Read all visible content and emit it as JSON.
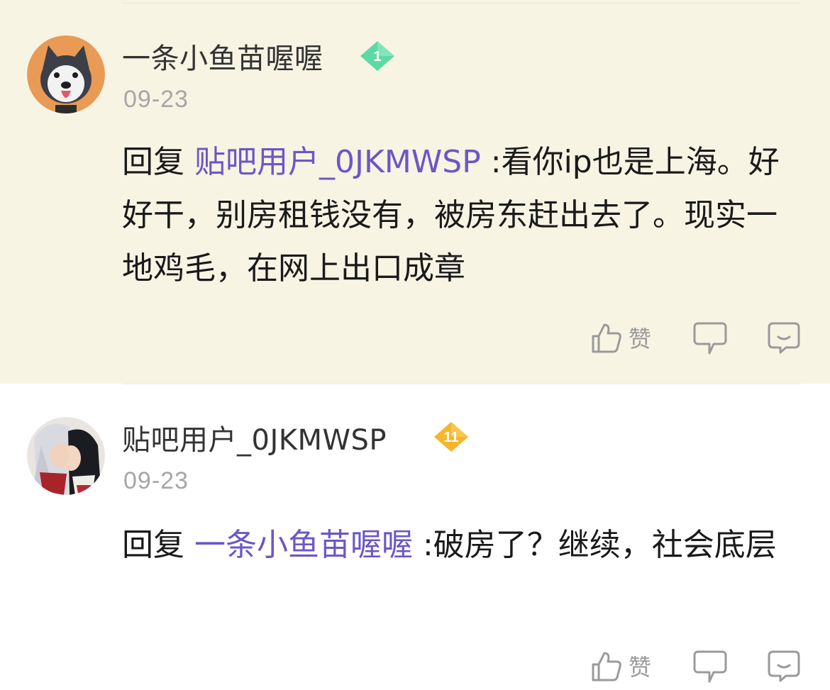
{
  "comments": [
    {
      "username": "一条小鱼苗喔喔",
      "level": "1",
      "level_color": "#5dd9a5",
      "date": "09-23",
      "reply_prefix": "回复",
      "mention": "贴吧用户_0JKMWSP",
      "text": " :看你ip也是上海。好好干，别房租钱没有，被房东赶出去了。现实一地鸡毛，在网上出口成章",
      "avatar": "husky-dog-avatar",
      "like_label": "赞"
    },
    {
      "username": "贴吧用户_0JKMWSP",
      "level": "11",
      "level_color": "#f7b52b",
      "date": "09-23",
      "reply_prefix": "回复",
      "mention": "一条小鱼苗喔喔",
      "text": " :破房了？继续，社会底层",
      "avatar": "anime-couple-avatar",
      "like_label": "赞"
    }
  ],
  "colors": {
    "highlight_bg": "#f8f4e4",
    "mention": "#6b57c7",
    "muted": "#a6a6a6",
    "icon": "#9a9a9a"
  },
  "icons": [
    "thumbs-up-icon",
    "reply-bubble-icon",
    "comment-bubble-icon"
  ]
}
